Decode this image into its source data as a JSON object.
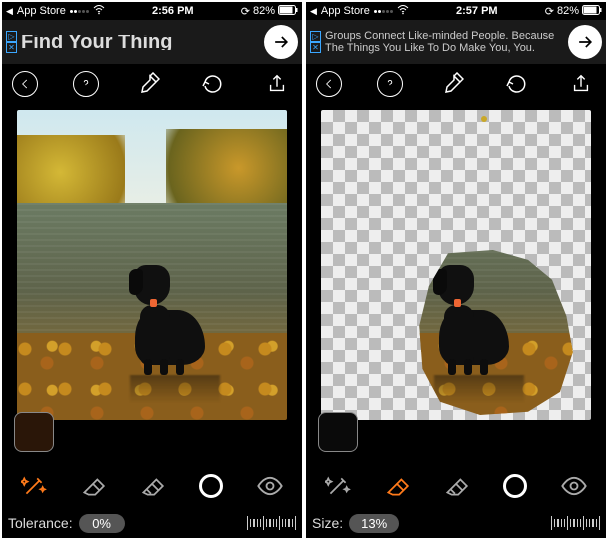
{
  "left": {
    "status": {
      "back": "App Store",
      "time": "2:56 PM",
      "battery": "82%"
    },
    "ad": {
      "text": "Find Your Thing"
    },
    "slider": {
      "label": "Tolerance:",
      "value": "0%"
    }
  },
  "right": {
    "status": {
      "back": "App Store",
      "time": "2:57 PM",
      "battery": "82%"
    },
    "ad": {
      "text": "Groups Connect Like-minded People. Because The Things You Like To Do Make You, You."
    },
    "slider": {
      "label": "Size:",
      "value": "13%"
    }
  },
  "icons": {
    "back": "back-chevron-icon",
    "help": "help-icon",
    "brush": "brush-icon",
    "undo": "undo-icon",
    "share": "share-icon",
    "wand": "wand-icon",
    "eraser": "eraser-icon",
    "restore": "restore-brush-icon",
    "target": "target-icon",
    "eye": "eye-icon",
    "adgo": "arrow-right-icon"
  }
}
